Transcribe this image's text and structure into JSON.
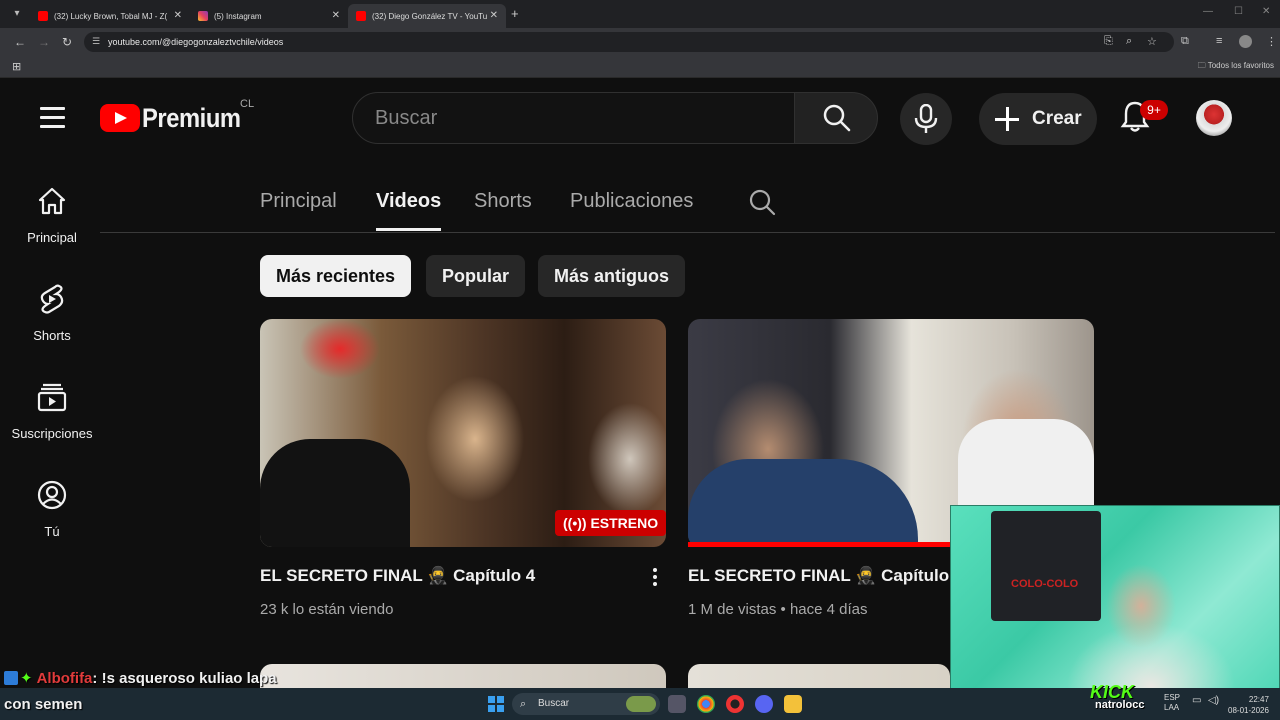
{
  "browser": {
    "tabs": [
      {
        "title": "(32) Lucky Brown, Tobal MJ - Z(",
        "favicon": "youtube-icon"
      },
      {
        "title": "(5) Instagram",
        "favicon": "instagram-icon"
      },
      {
        "title": "(32) Diego González TV - YouTu",
        "favicon": "youtube-icon"
      }
    ],
    "url": "youtube.com/@diegogonzaleztvchile/videos",
    "bookmarks_label": "Todos los favoritos"
  },
  "header": {
    "logo_text": "Premium",
    "country": "CL",
    "search_placeholder": "Buscar",
    "create_label": "Crear",
    "notifications_badge": "9+"
  },
  "sidebar": {
    "items": [
      {
        "label": "Principal",
        "icon": "home-icon"
      },
      {
        "label": "Shorts",
        "icon": "shorts-icon"
      },
      {
        "label": "Suscripciones",
        "icon": "subscriptions-icon"
      },
      {
        "label": "Tú",
        "icon": "you-icon"
      }
    ]
  },
  "channel_tabs": {
    "items": [
      "Principal",
      "Videos",
      "Shorts",
      "Publicaciones"
    ],
    "active": "Videos"
  },
  "chips": {
    "items": [
      "Más recientes",
      "Popular",
      "Más antiguos"
    ],
    "active": "Más recientes"
  },
  "videos": [
    {
      "title": "EL SECRETO FINAL 🥷 Capítulo 4",
      "meta": "23 k lo están viendo",
      "badge": "ESTRENO"
    },
    {
      "title": "EL SECRETO FINAL 🥷 Capítulo",
      "meta": "1 M de vistas • hace 4 días",
      "watch_progress": 0.65
    }
  ],
  "overlay": {
    "chat_user": "Albofifa",
    "chat_message": ": !s asqueroso kuliao lapa",
    "chat_continuation": "con semen",
    "webcam_poster_text": "COLO-COLO",
    "kick_logo": "KICK",
    "kick_user": "natrolocc"
  },
  "taskbar": {
    "search_label": "Buscar",
    "lang_top": "ESP",
    "lang_bottom": "LAA",
    "time": "22:47",
    "date": "08-01-2026"
  },
  "colors": {
    "background": "#0f0f0f",
    "accent_red": "#ff0000",
    "chip_active_bg": "#f1f1f1",
    "text_secondary": "#aaaaaa"
  }
}
